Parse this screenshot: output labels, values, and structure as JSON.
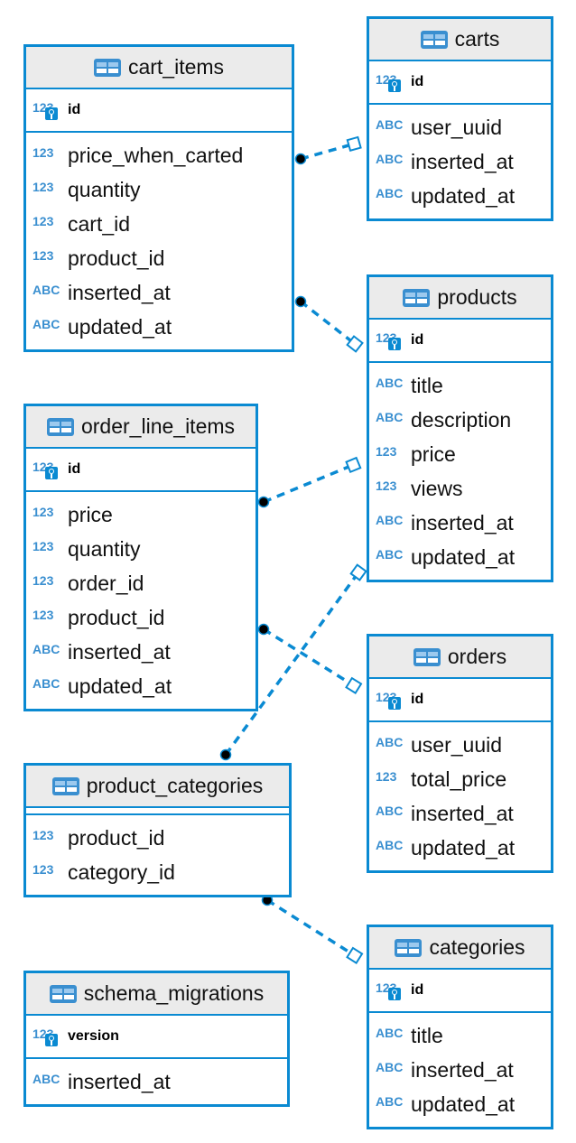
{
  "accent_color": "#0a8ad2",
  "tables": [
    {
      "name": "cart_items",
      "pk": [
        {
          "type": "123",
          "name": "id"
        }
      ],
      "columns": [
        {
          "type": "123",
          "name": "price_when_carted"
        },
        {
          "type": "123",
          "name": "quantity"
        },
        {
          "type": "123",
          "name": "cart_id"
        },
        {
          "type": "123",
          "name": "product_id"
        },
        {
          "type": "ABC",
          "name": "inserted_at"
        },
        {
          "type": "ABC",
          "name": "updated_at"
        }
      ]
    },
    {
      "name": "carts",
      "pk": [
        {
          "type": "123",
          "name": "id"
        }
      ],
      "columns": [
        {
          "type": "ABC",
          "name": "user_uuid"
        },
        {
          "type": "ABC",
          "name": "inserted_at"
        },
        {
          "type": "ABC",
          "name": "updated_at"
        }
      ]
    },
    {
      "name": "products",
      "pk": [
        {
          "type": "123",
          "name": "id"
        }
      ],
      "columns": [
        {
          "type": "ABC",
          "name": "title"
        },
        {
          "type": "ABC",
          "name": "description"
        },
        {
          "type": "123",
          "name": "price"
        },
        {
          "type": "123",
          "name": "views"
        },
        {
          "type": "ABC",
          "name": "inserted_at"
        },
        {
          "type": "ABC",
          "name": "updated_at"
        }
      ]
    },
    {
      "name": "order_line_items",
      "pk": [
        {
          "type": "123",
          "name": "id"
        }
      ],
      "columns": [
        {
          "type": "123",
          "name": "price"
        },
        {
          "type": "123",
          "name": "quantity"
        },
        {
          "type": "123",
          "name": "order_id"
        },
        {
          "type": "123",
          "name": "product_id"
        },
        {
          "type": "ABC",
          "name": "inserted_at"
        },
        {
          "type": "ABC",
          "name": "updated_at"
        }
      ]
    },
    {
      "name": "orders",
      "pk": [
        {
          "type": "123",
          "name": "id"
        }
      ],
      "columns": [
        {
          "type": "ABC",
          "name": "user_uuid"
        },
        {
          "type": "123",
          "name": "total_price"
        },
        {
          "type": "ABC",
          "name": "inserted_at"
        },
        {
          "type": "ABC",
          "name": "updated_at"
        }
      ]
    },
    {
      "name": "product_categories",
      "pk": [],
      "columns": [
        {
          "type": "123",
          "name": "product_id"
        },
        {
          "type": "123",
          "name": "category_id"
        }
      ]
    },
    {
      "name": "categories",
      "pk": [
        {
          "type": "123",
          "name": "id"
        }
      ],
      "columns": [
        {
          "type": "ABC",
          "name": "title"
        },
        {
          "type": "ABC",
          "name": "inserted_at"
        },
        {
          "type": "ABC",
          "name": "updated_at"
        }
      ]
    },
    {
      "name": "schema_migrations",
      "pk": [
        {
          "type": "123",
          "name": "version"
        }
      ],
      "columns": [
        {
          "type": "ABC",
          "name": "inserted_at"
        }
      ]
    }
  ],
  "relations": [
    {
      "from": "cart_items.cart_id",
      "to": "carts.id"
    },
    {
      "from": "cart_items.product_id",
      "to": "products.id"
    },
    {
      "from": "order_line_items.product_id",
      "to": "products.id"
    },
    {
      "from": "order_line_items.order_id",
      "to": "orders.id"
    },
    {
      "from": "product_categories.product_id",
      "to": "products.id"
    },
    {
      "from": "product_categories.category_id",
      "to": "categories.id"
    }
  ]
}
